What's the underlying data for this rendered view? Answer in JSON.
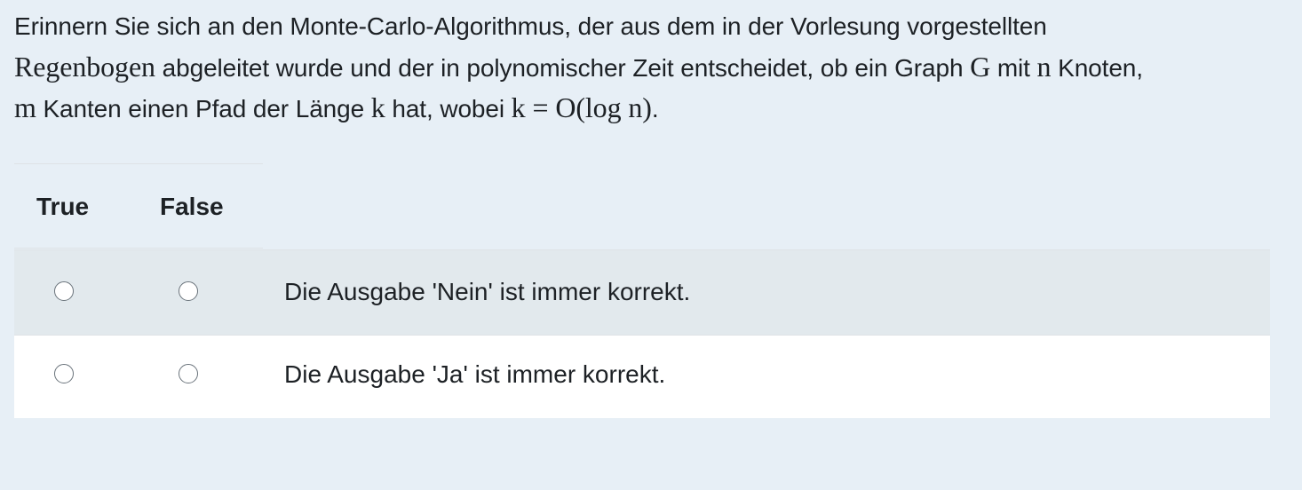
{
  "question": {
    "line1": "Erinnern Sie sich an den Monte-Carlo-Algorithmus, der aus dem in der Vorlesung vorgestellten",
    "line2_math_regenbogen": "Regenbogen",
    "line2_text_a": " abgeleitet wurde und der in polynomischer Zeit entscheidet, ob ein Graph ",
    "line2_math_g": "G",
    "line2_text_b": " mit ",
    "line2_math_n": "n",
    "line2_text_c": " Knoten,",
    "line3_math_m": "m",
    "line3_text_a": " Kanten einen Pfad der Länge ",
    "line3_math_k": "k",
    "line3_text_b": " hat, wobei ",
    "line3_math_formula": "k = O(log n)",
    "line3_text_c": "."
  },
  "table": {
    "headers": {
      "true_label": "True",
      "false_label": "False"
    },
    "rows": [
      {
        "statement": "Die Ausgabe 'Nein' ist immer korrekt.",
        "selected": null
      },
      {
        "statement": "Die Ausgabe 'Ja' ist immer korrekt.",
        "selected": null
      }
    ]
  }
}
